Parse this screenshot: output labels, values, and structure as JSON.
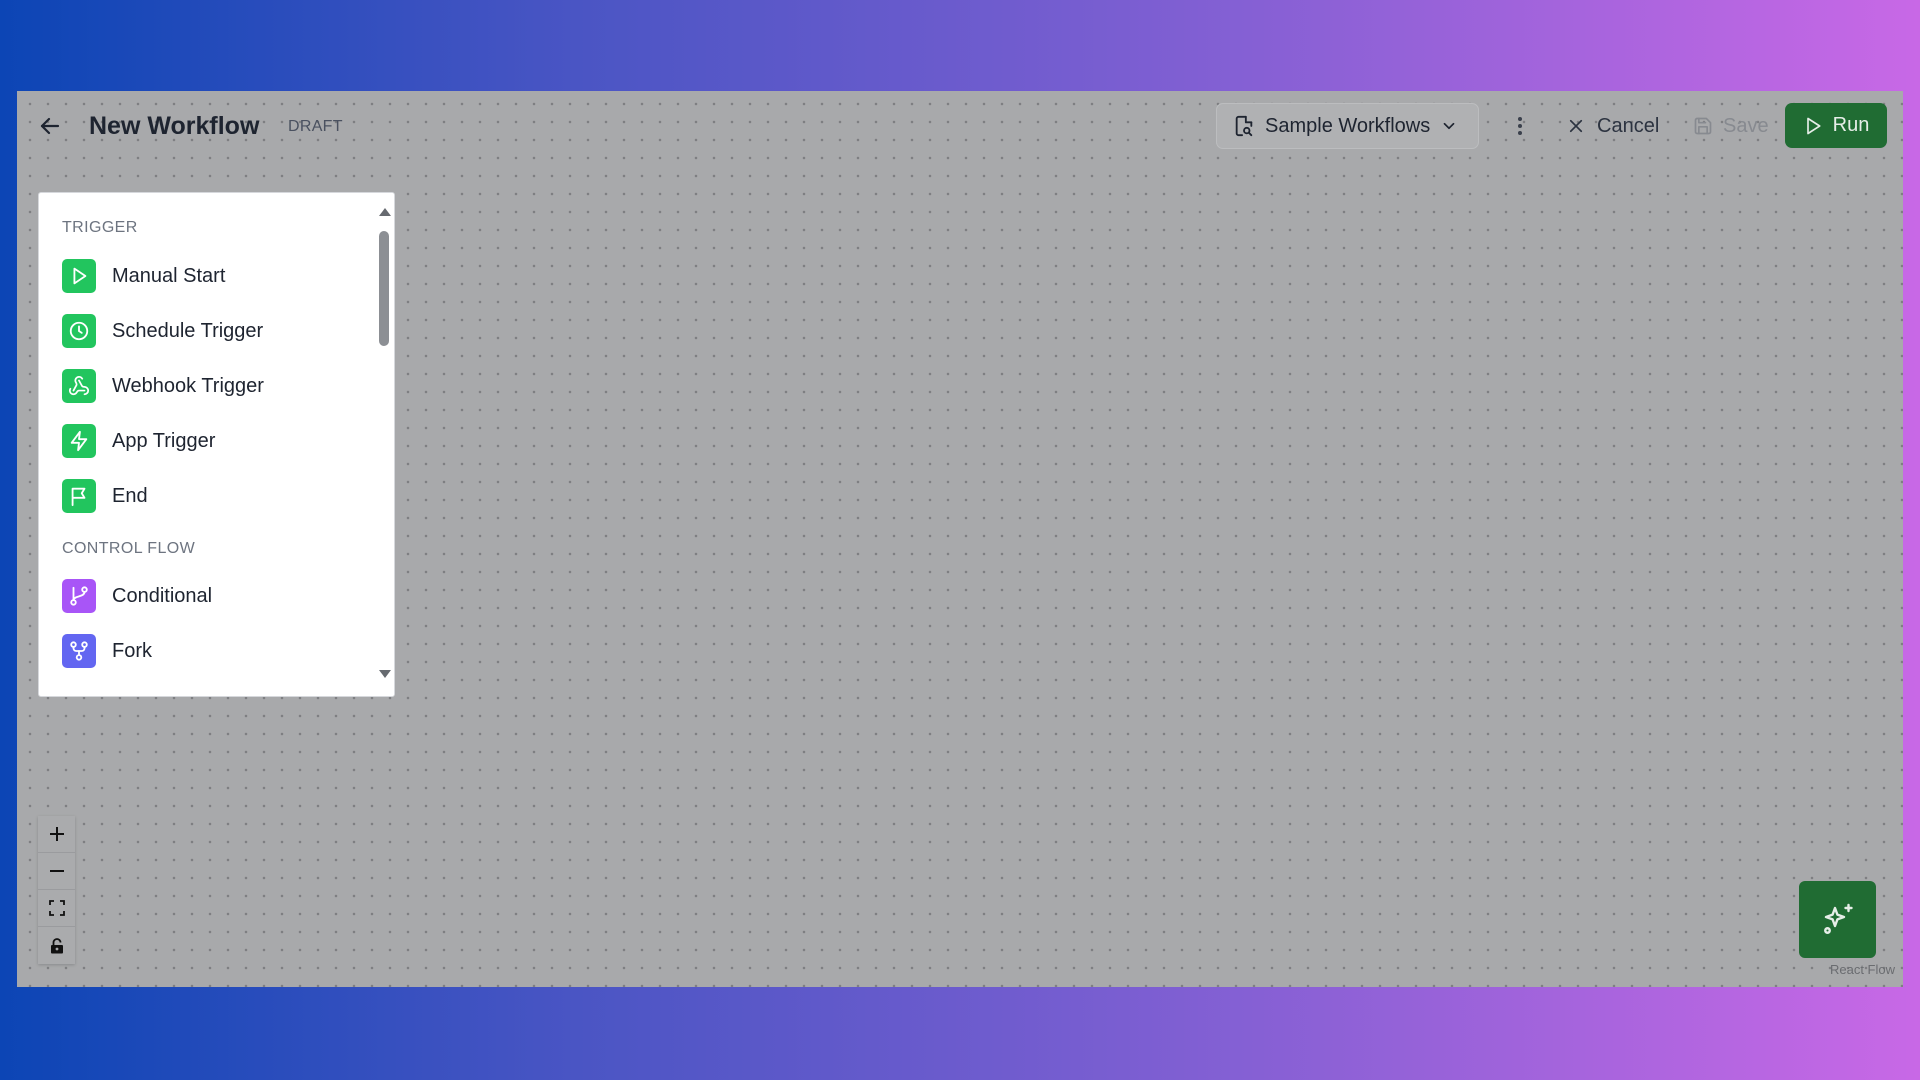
{
  "header": {
    "title": "New Workflow",
    "status_badge": "DRAFT",
    "sample_workflows_label": "Sample Workflows",
    "cancel_label": "Cancel",
    "save_label": "Save",
    "run_label": "Run"
  },
  "palette": {
    "sections": [
      {
        "title": "TRIGGER",
        "items": [
          {
            "label": "Manual Start",
            "icon": "play-icon",
            "color": "#22c55e"
          },
          {
            "label": "Schedule Trigger",
            "icon": "clock-icon",
            "color": "#22c55e"
          },
          {
            "label": "Webhook Trigger",
            "icon": "webhook-icon",
            "color": "#22c55e"
          },
          {
            "label": "App Trigger",
            "icon": "lightning-icon",
            "color": "#22c55e"
          },
          {
            "label": "End",
            "icon": "flag-icon",
            "color": "#22c55e"
          }
        ]
      },
      {
        "title": "CONTROL FLOW",
        "items": [
          {
            "label": "Conditional",
            "icon": "branch-icon",
            "color": "#a855f7"
          },
          {
            "label": "Fork",
            "icon": "fork-icon",
            "color": "#6366f1"
          }
        ]
      }
    ]
  },
  "canvas": {
    "attribution": "React Flow",
    "zoom_in_icon": "plus-icon",
    "zoom_out_icon": "minus-icon",
    "fit_view_icon": "fit-view-icon",
    "lock_icon": "lock-icon"
  },
  "colors": {
    "accent": "#206c33",
    "trigger_icon_bg": "#22c55e",
    "conditional_icon_bg": "#a855f7",
    "fork_icon_bg": "#6366f1"
  }
}
